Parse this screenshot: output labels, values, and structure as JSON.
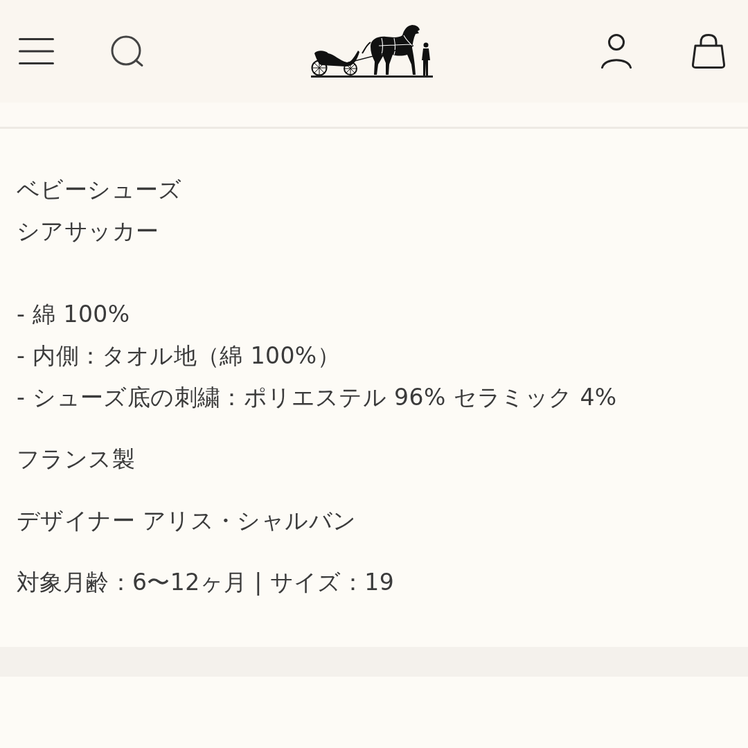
{
  "description": {
    "product_name": "ベビーシューズ",
    "material_name": "シアサッカー",
    "composition": [
      "- 綿 100%",
      "- 内側：タオル地（綿 100%）",
      "- シューズ底の刺繍：ポリエステル 96% セラミック 4%"
    ],
    "origin": "フランス製",
    "designer": "デザイナー アリス・シャルバン",
    "specs": "対象月齢：6〜12ヶ月 | サイズ：19"
  }
}
